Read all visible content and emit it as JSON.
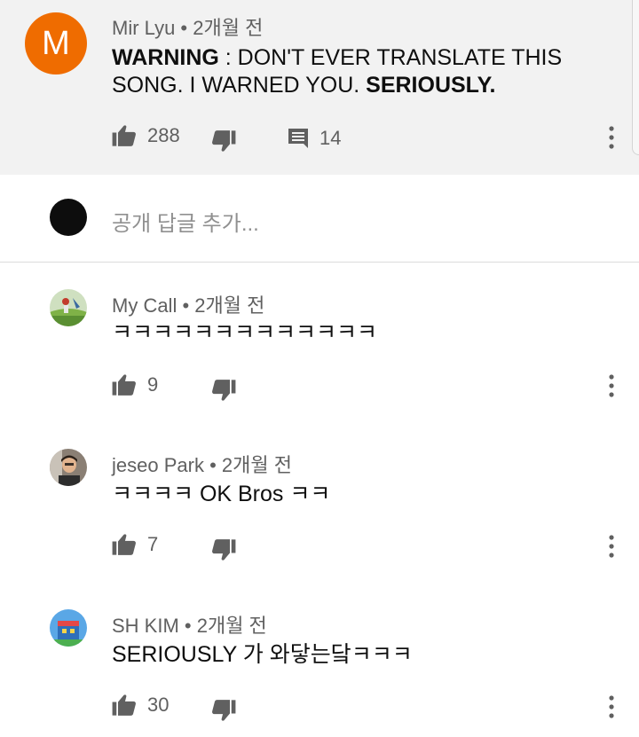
{
  "top_comment": {
    "avatar_letter": "M",
    "author": "Mir Lyu",
    "time": "2개월 전",
    "text_line1_bold": "WARNING",
    "text_line1_rest": " : DON'T EVER TRANSLATE THIS",
    "text_line2_rest": "SONG. I WARNED YOU. ",
    "text_line2_bold": "SERIOUSLY.",
    "likes": "288",
    "replies": "14",
    "avatar_color": "#ef6c00"
  },
  "reply_box": {
    "placeholder": "공개 답글 추가..."
  },
  "comments": [
    {
      "author": "My Call",
      "time": "2개월 전",
      "text": "ㅋㅋㅋㅋㅋㅋㅋㅋㅋㅋㅋㅋㅋ",
      "likes": "9"
    },
    {
      "author": "jeseo Park",
      "time": "2개월 전",
      "text": "ㅋㅋㅋㅋ OK Bros ㅋㅋ",
      "likes": "7"
    },
    {
      "author": "SH KIM",
      "time": "2개월 전",
      "text": "SERIOUSLY 가 와닿는닼ㅋㅋㅋ",
      "likes": "30"
    }
  ],
  "separator": " • ",
  "icons": {
    "like": "thumbs-up-icon",
    "dislike": "thumbs-down-icon",
    "reply": "comment-icon",
    "menu": "more-vertical-icon"
  }
}
